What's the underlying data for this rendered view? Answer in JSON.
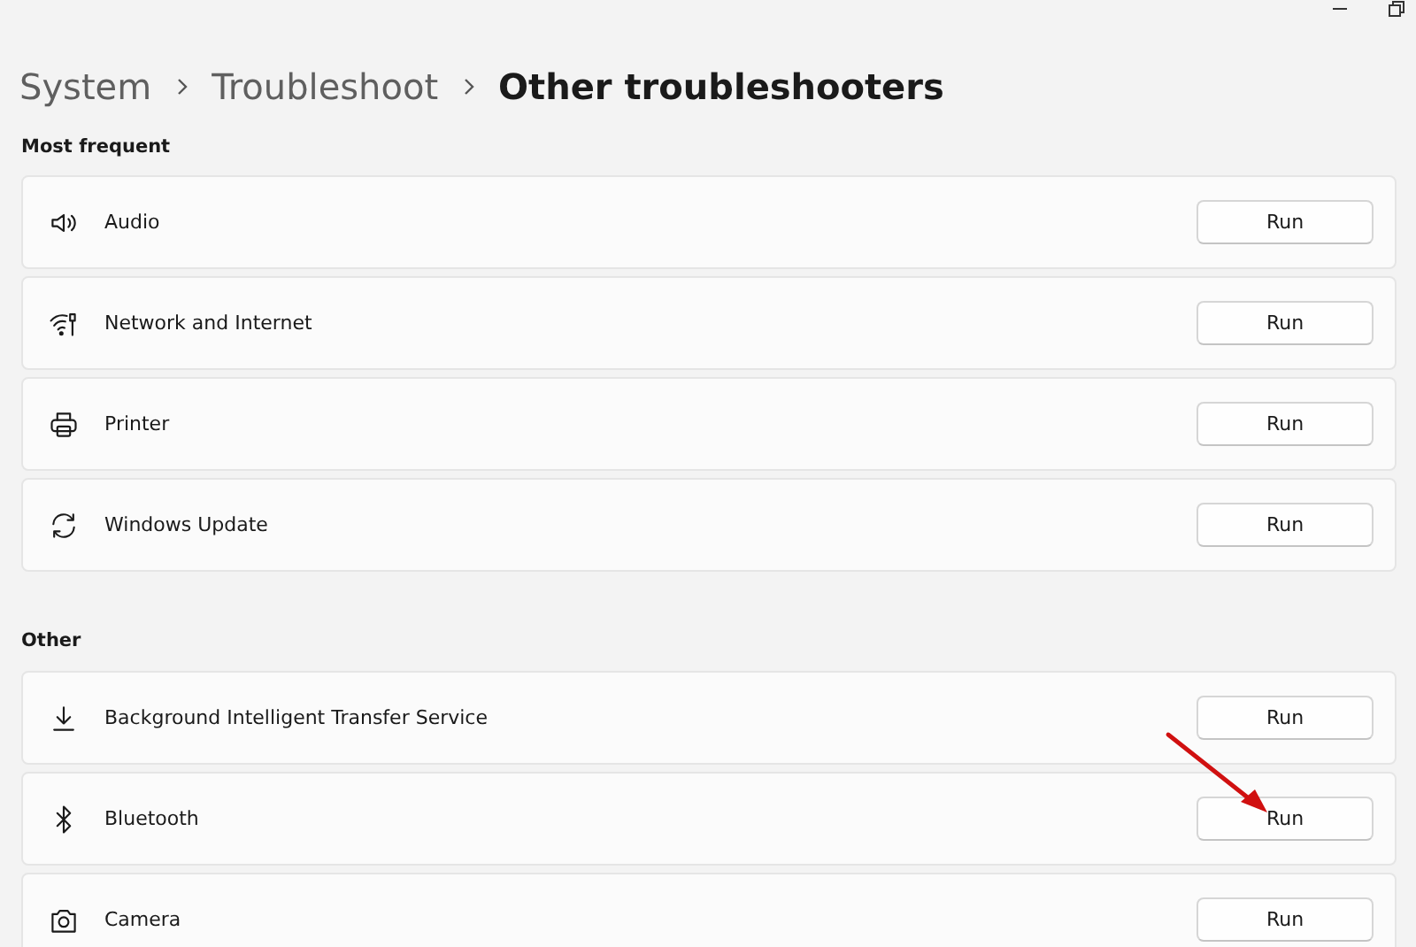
{
  "breadcrumb": [
    {
      "label": "System",
      "current": false
    },
    {
      "label": "Troubleshoot",
      "current": false
    },
    {
      "label": "Other troubleshooters",
      "current": true
    }
  ],
  "sections": [
    {
      "title": "Most frequent",
      "items": [
        {
          "kind": "speaker",
          "label": "Audio",
          "button": "Run",
          "pointed": false
        },
        {
          "kind": "wifi",
          "label": "Network and Internet",
          "button": "Run",
          "pointed": false
        },
        {
          "kind": "printer",
          "label": "Printer",
          "button": "Run",
          "pointed": false
        },
        {
          "kind": "refresh",
          "label": "Windows Update",
          "button": "Run",
          "pointed": false
        }
      ]
    },
    {
      "title": "Other",
      "items": [
        {
          "kind": "download",
          "label": "Background Intelligent Transfer Service",
          "button": "Run",
          "pointed": false
        },
        {
          "kind": "bluetooth",
          "label": "Bluetooth",
          "button": "Run",
          "pointed": true
        },
        {
          "kind": "camera",
          "label": "Camera",
          "button": "Run",
          "pointed": false
        }
      ]
    }
  ]
}
